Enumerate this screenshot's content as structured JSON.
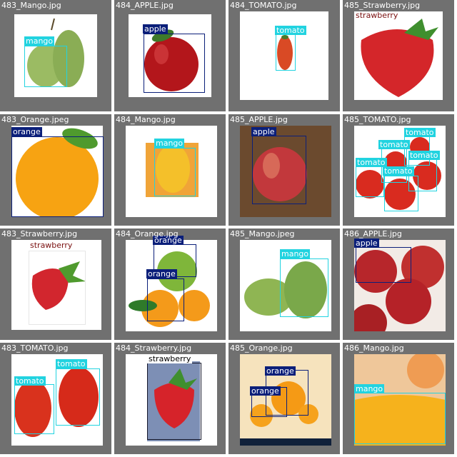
{
  "tiles": [
    {
      "file": "483_Mango.jpg",
      "labels": [
        "mango"
      ]
    },
    {
      "file": "484_APPLE.jpg",
      "labels": [
        "apple"
      ]
    },
    {
      "file": "484_TOMATO.jpg",
      "labels": [
        "tomato"
      ]
    },
    {
      "file": "485_Strawberry.jpg",
      "labels": [
        "strawberry"
      ]
    },
    {
      "file": "483_Orange.jpeg",
      "labels": [
        "orange"
      ]
    },
    {
      "file": "484_Mango.jpg",
      "labels": [
        "mango"
      ]
    },
    {
      "file": "485_APPLE.jpg",
      "labels": [
        "apple"
      ]
    },
    {
      "file": "485_TOMATO.jpg",
      "labels": [
        "tomato",
        "tomato",
        "tomato",
        "tomato",
        "tomato"
      ]
    },
    {
      "file": "483_Strawberry.jpg",
      "labels": [
        "strawberry"
      ]
    },
    {
      "file": "484_Orange.jpg",
      "labels": [
        "orange",
        "orange"
      ]
    },
    {
      "file": "485_Mango.jpeg",
      "labels": [
        "mango"
      ]
    },
    {
      "file": "486_APPLE.jpg",
      "labels": [
        "apple"
      ]
    },
    {
      "file": "483_TOMATO.jpg",
      "labels": [
        "tomato",
        "tomato"
      ]
    },
    {
      "file": "484_Strawberry.jpg",
      "labels": [
        "strawberry"
      ]
    },
    {
      "file": "485_Orange.jpg",
      "labels": [
        "orange",
        "orange"
      ]
    },
    {
      "file": "486_Mango.jpg",
      "labels": [
        "mango"
      ]
    }
  ],
  "colors": {
    "tile_background": "#707070",
    "mango_box": "#22d3e0",
    "tomato_box": "#22d3e0",
    "apple_box": "#0b1f7a",
    "orange_box": "#0b1f7a"
  }
}
